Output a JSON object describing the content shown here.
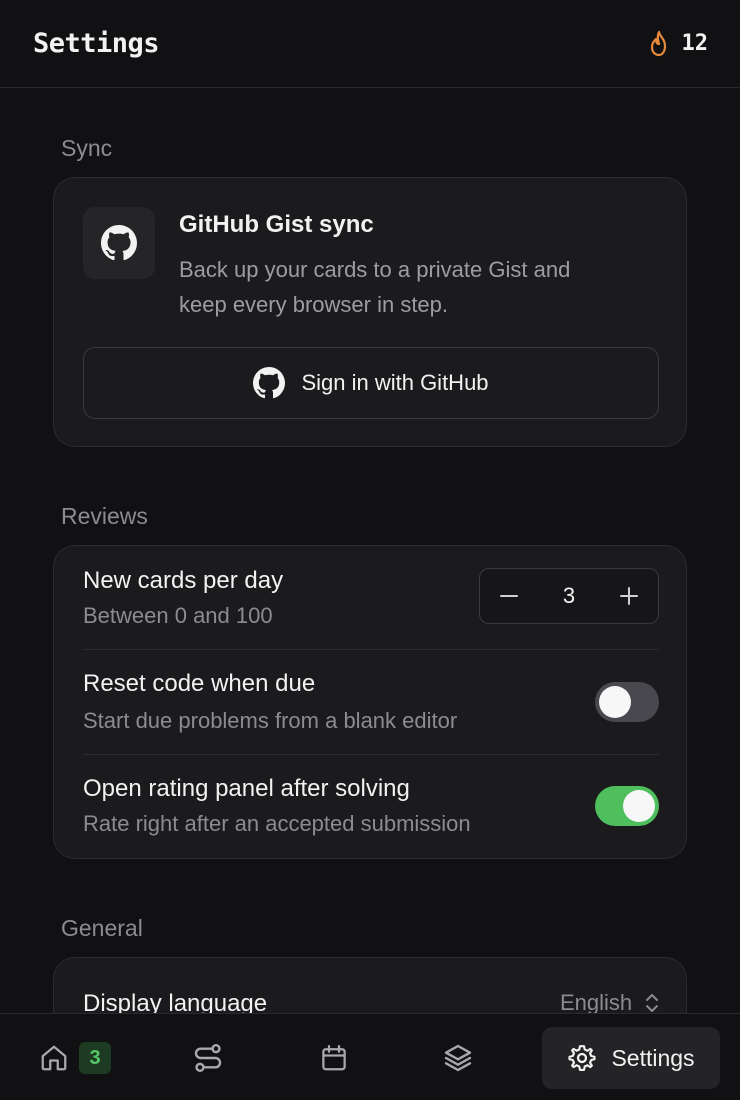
{
  "header": {
    "title": "Settings",
    "streak_count": "12",
    "streak_icon": "flame-icon",
    "accent": "#e48a3a"
  },
  "sync": {
    "section_label": "Sync",
    "title": "GitHub Gist sync",
    "description_line1": "Back up your cards to a private Gist and",
    "description_line2": "keep every browser in step.",
    "signin_label": "Sign in with GitHub"
  },
  "reviews": {
    "section_label": "Reviews",
    "new_cards": {
      "title": "New cards per day",
      "subtitle": "Between 0 and 100",
      "value": "3"
    },
    "reset_code": {
      "title": "Reset code when due",
      "subtitle": "Start due problems from a blank editor",
      "enabled": false
    },
    "open_rating": {
      "title": "Open rating panel after solving",
      "subtitle": "Rate right after an accepted submission",
      "enabled": true
    }
  },
  "general": {
    "section_label": "General",
    "display_language": {
      "title": "Display language",
      "value": "English"
    }
  },
  "bottom_nav": {
    "home_badge": "3",
    "active_label": "Settings",
    "items": [
      "home-icon",
      "route-icon",
      "calendar-icon",
      "layers-icon",
      "gear-icon"
    ]
  },
  "colors": {
    "background": "#111113",
    "card": "#1b1b1e",
    "toggle_on": "#4fbf5d",
    "badge_text": "#57c76a"
  }
}
